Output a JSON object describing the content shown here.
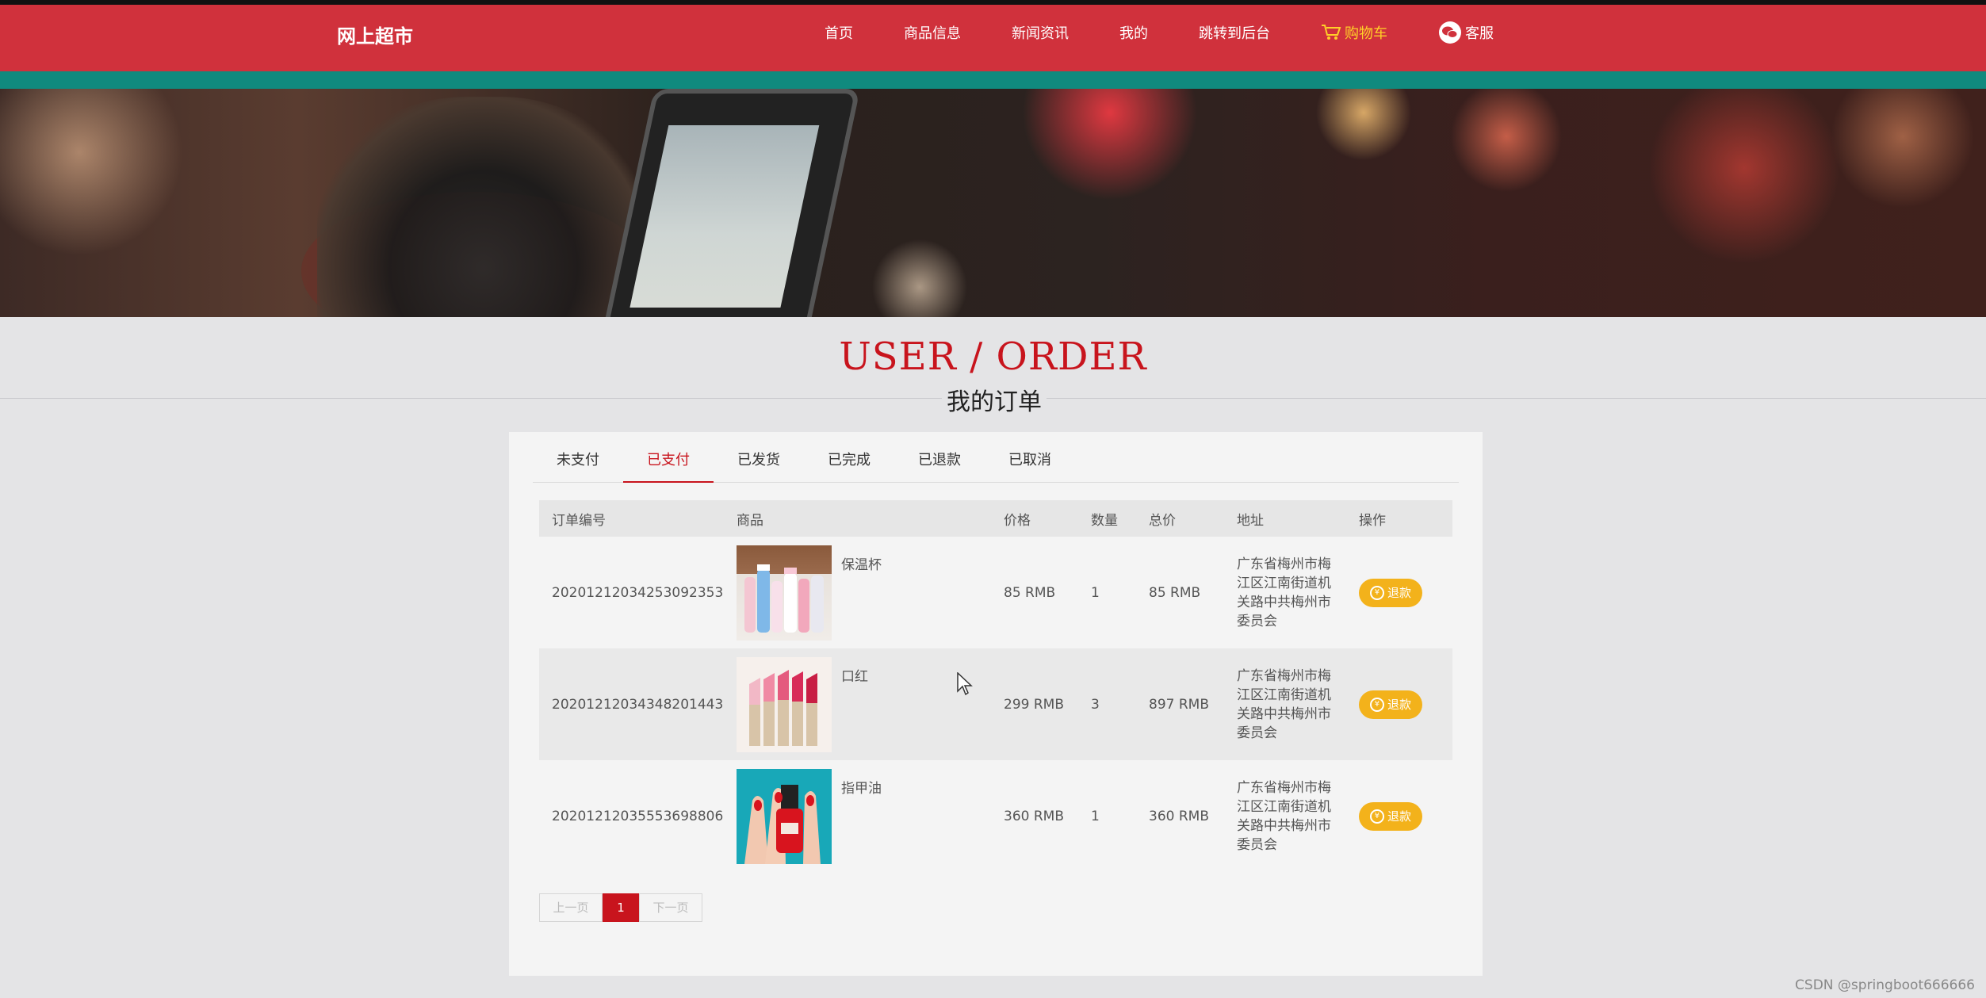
{
  "header": {
    "logo": "网上超市",
    "nav": [
      {
        "label": "首页"
      },
      {
        "label": "商品信息"
      },
      {
        "label": "新闻资讯"
      },
      {
        "label": "我的"
      },
      {
        "label": "跳转到后台"
      },
      {
        "label": "购物车",
        "icon": "cart-icon"
      },
      {
        "label": "客服",
        "icon": "wechat-icon"
      }
    ],
    "colors": {
      "bar": "#d0313c",
      "strip": "#108a7e",
      "cart": "#ffd028"
    }
  },
  "title": {
    "en": "USER / ORDER",
    "cn": "我的订单"
  },
  "tabs": [
    {
      "label": "未支付"
    },
    {
      "label": "已支付",
      "active": true
    },
    {
      "label": "已发货"
    },
    {
      "label": "已完成"
    },
    {
      "label": "已退款"
    },
    {
      "label": "已取消"
    }
  ],
  "table": {
    "columns": [
      "订单编号",
      "商品",
      "价格",
      "数量",
      "总价",
      "地址",
      "操作"
    ],
    "rows": [
      {
        "order_no": "20201212034253092353",
        "product": "保温杯",
        "image": "thermos-bottles-image",
        "price": "85 RMB",
        "qty": "1",
        "total": "85 RMB",
        "address": "广东省梅州市梅江区江南街道机关路中共梅州市委员会",
        "action": "退款"
      },
      {
        "order_no": "20201212034348201443",
        "product": "口红",
        "image": "lipsticks-image",
        "price": "299 RMB",
        "qty": "3",
        "total": "897 RMB",
        "address": "广东省梅州市梅江区江南街道机关路中共梅州市委员会",
        "action": "退款"
      },
      {
        "order_no": "20201212035553698806",
        "product": "指甲油",
        "image": "nail-polish-image",
        "price": "360 RMB",
        "qty": "1",
        "total": "360 RMB",
        "address": "广东省梅州市梅江区江南街道机关路中共梅州市委员会",
        "action": "退款"
      }
    ]
  },
  "pager": {
    "prev": "上一页",
    "current": "1",
    "next": "下一页"
  },
  "watermark": "CSDN @springboot666666",
  "accent": "#c8141d",
  "button_color": "#f3b21b"
}
